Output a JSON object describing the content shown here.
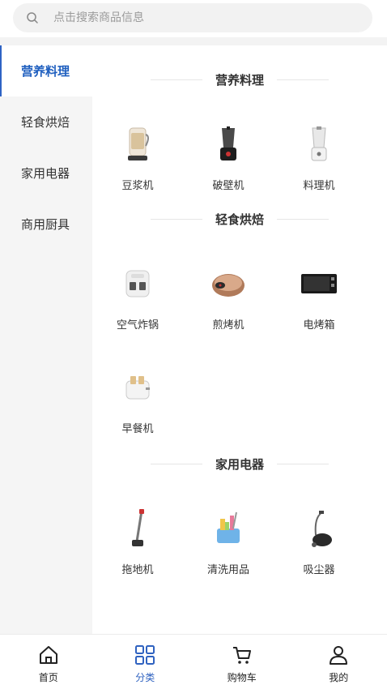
{
  "search": {
    "placeholder": "点击搜索商品信息"
  },
  "sidebar": {
    "items": [
      {
        "label": "营养料理",
        "active": true
      },
      {
        "label": "轻食烘焙",
        "active": false
      },
      {
        "label": "家用电器",
        "active": false
      },
      {
        "label": "商用厨具",
        "active": false
      }
    ]
  },
  "sections": [
    {
      "title": "营养料理",
      "items": [
        {
          "label": "豆浆机",
          "icon": "soymilk-maker-icon"
        },
        {
          "label": "破壁机",
          "icon": "blender-icon"
        },
        {
          "label": "料理机",
          "icon": "food-processor-icon"
        }
      ]
    },
    {
      "title": "轻食烘焙",
      "items": [
        {
          "label": "空气炸锅",
          "icon": "air-fryer-icon"
        },
        {
          "label": "煎烤机",
          "icon": "grill-pan-icon"
        },
        {
          "label": "电烤箱",
          "icon": "electric-oven-icon"
        },
        {
          "label": "早餐机",
          "icon": "toaster-icon"
        }
      ]
    },
    {
      "title": "家用电器",
      "items": [
        {
          "label": "拖地机",
          "icon": "mop-icon"
        },
        {
          "label": "清洗用品",
          "icon": "cleaning-supplies-icon"
        },
        {
          "label": "吸尘器",
          "icon": "vacuum-cleaner-icon"
        }
      ]
    }
  ],
  "tabbar": {
    "tabs": [
      {
        "label": "首页",
        "icon": "home-icon"
      },
      {
        "label": "分类",
        "icon": "category-icon",
        "active": true
      },
      {
        "label": "购物车",
        "icon": "cart-icon"
      },
      {
        "label": "我的",
        "icon": "profile-icon"
      }
    ]
  },
  "colors": {
    "accent": "#2f62c0",
    "sidebar_bg": "#f5f5f5"
  }
}
